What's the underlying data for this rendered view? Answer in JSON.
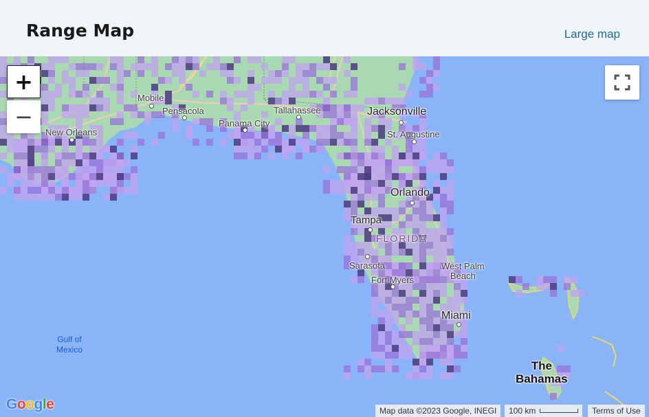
{
  "header": {
    "title": "Range Map",
    "large_map_link": "Large map"
  },
  "map": {
    "controls": {
      "zoom_in": "+",
      "zoom_out": "−"
    },
    "labels": {
      "mobile": "Mobile",
      "pensacola": "Pensacola",
      "tallahassee": "Tallahassee",
      "panama_city": "Panama City",
      "jacksonville": "Jacksonville",
      "st_augustine": "St. Augustine",
      "new_orleans": "New Orleans",
      "orlando": "Orlando",
      "tampa": "Tampa",
      "florida": "FLORIDA",
      "sarasota": "Sarasota",
      "west_palm_beach": "West Palm\nBeach",
      "fort_myers": "Fort Myers",
      "miami": "Miami",
      "gulf_of_mexico": "Gulf of\nMexico",
      "the_bahamas": "The\nBahamas"
    },
    "attribution": {
      "map_data": "Map data ©2023 Google, INEGI",
      "scale": "100 km",
      "terms": "Terms of Use"
    },
    "logo": {
      "g1": "G",
      "o1": "o",
      "o2": "o",
      "g2": "g",
      "l": "l",
      "e": "e"
    },
    "colors": {
      "water": "#8ab4f8",
      "land": "#a8d9b0",
      "range_light": "#c2a3f0",
      "range_mid": "#9a72d9",
      "range_dark": "#4b3a80"
    }
  }
}
